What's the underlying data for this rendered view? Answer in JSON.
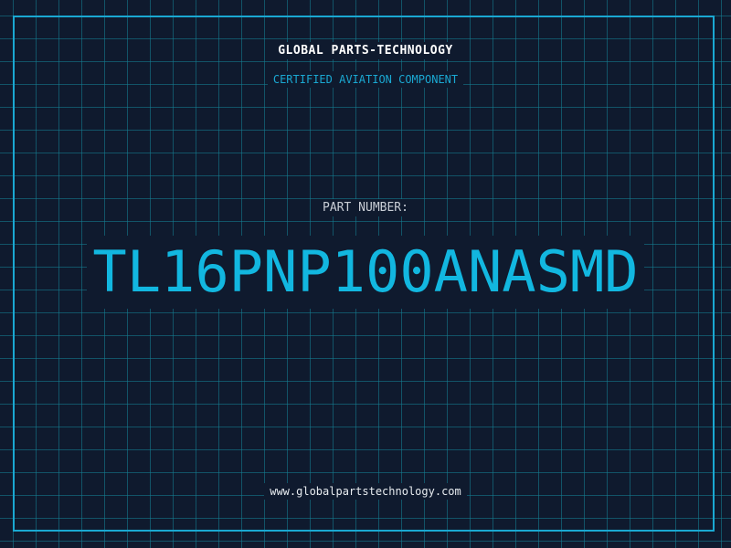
{
  "header": {
    "company": "GLOBAL PARTS-TECHNOLOGY",
    "tagline": "CERTIFIED AVIATION COMPONENT"
  },
  "part": {
    "label": "PART NUMBER:",
    "number": "TL16PNP100ANASMD"
  },
  "footer": {
    "website": "www.globalpartstechnology.com"
  },
  "colors": {
    "background": "#0f1a2e",
    "accent": "#12b7e0",
    "grid": "#148296",
    "text": "#ffffff"
  }
}
